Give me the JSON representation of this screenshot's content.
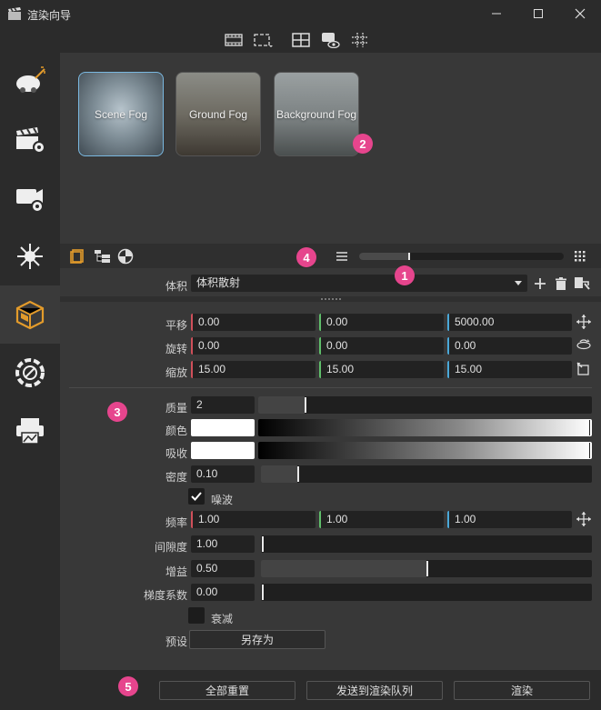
{
  "window": {
    "title": "渲染向导"
  },
  "presets": [
    {
      "label": "Scene Fog"
    },
    {
      "label": "Ground Fog"
    },
    {
      "label": "Background Fog"
    }
  ],
  "markers": [
    "1",
    "2",
    "3",
    "4",
    "5"
  ],
  "volume": {
    "label": "体积",
    "value": "体积散射"
  },
  "transform": {
    "translate": {
      "label": "平移",
      "x": "0.00",
      "y": "0.00",
      "z": "5000.00"
    },
    "rotate": {
      "label": "旋转",
      "x": "0.00",
      "y": "0.00",
      "z": "0.00"
    },
    "scale": {
      "label": "缩放",
      "x": "15.00",
      "y": "15.00",
      "z": "15.00"
    }
  },
  "params": {
    "quality": {
      "label": "质量",
      "value": "2",
      "level": 0.14
    },
    "color": {
      "label": "颜色"
    },
    "absorb": {
      "label": "吸收"
    },
    "density": {
      "label": "密度",
      "value": "0.10",
      "level": 0.11
    },
    "noise": {
      "label": "噪波",
      "checked": true
    },
    "frequency": {
      "label": "频率",
      "x": "1.00",
      "y": "1.00",
      "z": "1.00"
    },
    "gap": {
      "label": "间隙度",
      "value": "1.00",
      "level": 0.0
    },
    "gain": {
      "label": "增益",
      "value": "0.50",
      "level": 0.5
    },
    "gradient": {
      "label": "梯度系数",
      "value": "0.00",
      "level": 0.0
    },
    "falloff": {
      "label": "衰减",
      "checked": false
    },
    "preset": {
      "label": "预设",
      "save_as": "另存为"
    }
  },
  "footer": {
    "reset_all": "全部重置",
    "send_queue": "发送到渲染队列",
    "render": "渲染"
  },
  "colors": {
    "accent": "#e39b2b",
    "marker": "#e6458d",
    "selected": "#7ab8e0"
  }
}
